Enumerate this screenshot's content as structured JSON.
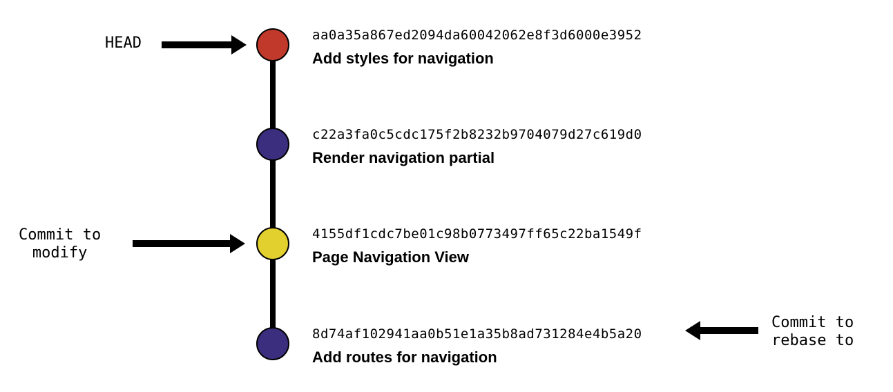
{
  "labels": {
    "head": "HEAD",
    "modify": "Commit to\nmodify",
    "rebase": "Commit to\nrebase to"
  },
  "commits": [
    {
      "hash": "aa0a35a867ed2094da60042062e8f3d6000e3952",
      "message": "Add styles for navigation",
      "color": "#c0392b"
    },
    {
      "hash": "c22a3fa0c5cdc175f2b8232b9704079d27c619d0",
      "message": "Render navigation partial",
      "color": "#3b2e7e"
    },
    {
      "hash": "4155df1cdc7be01c98b0773497ff65c22ba1549f",
      "message": "Page Navigation View",
      "color": "#e2d02e"
    },
    {
      "hash": "8d74af102941aa0b51e1a35b8ad731284e4b5a20",
      "message": "Add routes for navigation",
      "color": "#3b2e7e"
    }
  ]
}
